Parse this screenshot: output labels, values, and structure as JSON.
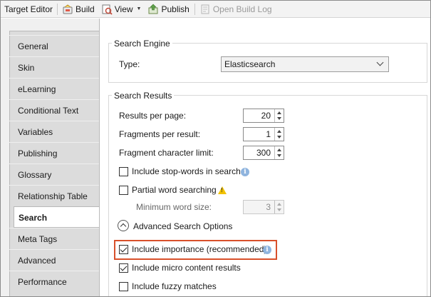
{
  "toolbar": {
    "title": "Target Editor",
    "build_label": "Build",
    "view_label": "View",
    "publish_label": "Publish",
    "open_build_log_label": "Open Build Log"
  },
  "tabs": [
    {
      "label": "General",
      "active": false
    },
    {
      "label": "Skin",
      "active": false
    },
    {
      "label": "eLearning",
      "active": false
    },
    {
      "label": "Conditional Text",
      "active": false
    },
    {
      "label": "Variables",
      "active": false
    },
    {
      "label": "Publishing",
      "active": false
    },
    {
      "label": "Glossary",
      "active": false
    },
    {
      "label": "Relationship Table",
      "active": false
    },
    {
      "label": "Search",
      "active": true
    },
    {
      "label": "Meta Tags",
      "active": false
    },
    {
      "label": "Advanced",
      "active": false
    },
    {
      "label": "Performance",
      "active": false
    }
  ],
  "search_engine": {
    "title": "Search Engine",
    "type_label": "Type:",
    "type_value": "Elasticsearch"
  },
  "search_results": {
    "title": "Search Results",
    "results_per_page_label": "Results per page:",
    "results_per_page_value": "20",
    "fragments_per_result_label": "Fragments per result:",
    "fragments_per_result_value": "1",
    "fragment_char_limit_label": "Fragment character limit:",
    "fragment_char_limit_value": "300",
    "include_stop_words_label": "Include stop-words in search",
    "include_stop_words_checked": false,
    "partial_word_label": "Partial word searching",
    "partial_word_checked": false,
    "min_word_size_label": "Minimum word size:",
    "min_word_size_value": "3",
    "advanced_options_label": "Advanced Search Options",
    "include_importance_label": "Include importance (recommended)",
    "include_importance_checked": true,
    "include_micro_content_label": "Include micro content results",
    "include_micro_content_checked": true,
    "include_fuzzy_label": "Include fuzzy matches",
    "include_fuzzy_checked": false
  },
  "colors": {
    "highlight": "#d8502b",
    "info": "#8fb4de",
    "warning": "#f2c200"
  }
}
